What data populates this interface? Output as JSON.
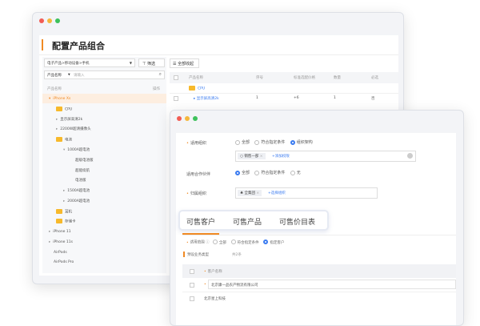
{
  "back": {
    "title": "配置产品组合",
    "category_select": "电子产品>移动设备>手机",
    "filter_label": "筛选",
    "search_field": "产品名称",
    "search_placeholder": "请输入",
    "tree_header": {
      "name": "产品名称",
      "action": "操作"
    },
    "tree": [
      {
        "label": "iPhone Xs",
        "level": 0,
        "type": "caret-open",
        "selected": true
      },
      {
        "label": "CPU",
        "level": 1,
        "type": "folder"
      },
      {
        "label": "显示屏高清2k",
        "level": 1,
        "type": "caret"
      },
      {
        "label": "2200W超清摄像头",
        "level": 1,
        "type": "caret"
      },
      {
        "label": "电池",
        "level": 1,
        "type": "folder"
      },
      {
        "label": "1000A超电池",
        "level": 2,
        "type": "caret-open"
      },
      {
        "label": "超级电池版",
        "level": 3,
        "type": "leaf"
      },
      {
        "label": "超能续航",
        "level": 3,
        "type": "leaf"
      },
      {
        "label": "电池版",
        "level": 3,
        "type": "leaf"
      },
      {
        "label": "1500A超电池",
        "level": 2,
        "type": "caret"
      },
      {
        "label": "2000A超电池",
        "level": 2,
        "type": "caret"
      },
      {
        "label": "耳机",
        "level": 1,
        "type": "folder"
      },
      {
        "label": "存储卡",
        "level": 1,
        "type": "folder"
      },
      {
        "label": "iPhone 11",
        "level": 0,
        "type": "caret"
      },
      {
        "label": "iPhone 11s",
        "level": 0,
        "type": "caret"
      },
      {
        "label": "AirPods",
        "level": 0,
        "type": "leaf"
      },
      {
        "label": "AirPods Pro",
        "level": 0,
        "type": "leaf"
      }
    ],
    "collapse_all": "全部收起",
    "table_headers": [
      "产品名称",
      "序号",
      "标准选配价格",
      "数量",
      "必选"
    ],
    "table_rows": [
      {
        "name": "CPU",
        "folder": true
      },
      {
        "name": "显示屏高清2k",
        "seq": "1",
        "price": "+6",
        "qty": "1",
        "required": "否"
      }
    ]
  },
  "front": {
    "org_label": "适用组织",
    "org_options": [
      "全部",
      "符合指定条件",
      "组织架构"
    ],
    "org_tag": "销售一部",
    "org_add": "+添加权限",
    "partner_label": "适用合作伙伴",
    "partner_options": [
      "全部",
      "符合指定条件",
      "无"
    ],
    "belong_label": "归属组织",
    "belong_tag": "全集团",
    "belong_add": "+选择组织",
    "tabs": [
      "可售客户",
      "可售产品",
      "可售价目表"
    ],
    "scope_label": "适用范围",
    "scope_options": [
      "全部",
      "符合指定条件",
      "指定客户"
    ],
    "section_title": "预设业务类型",
    "section_count": "共2条",
    "col_header": "客户名称",
    "rows": [
      "北京康一品农产物流有限公司",
      "北京星上科技"
    ]
  },
  "colors": {
    "accent": "#f08a24",
    "blue": "#3a7bf0"
  }
}
